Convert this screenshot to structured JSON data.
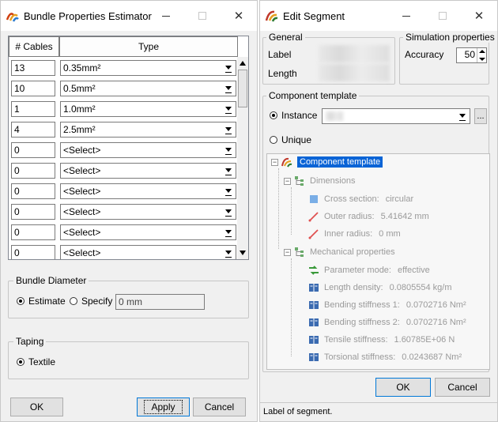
{
  "bundle_window": {
    "title": "Bundle Properties Estimator",
    "columns": [
      "# Cables",
      "Type"
    ],
    "rows": [
      {
        "count": "13",
        "type": "0.35mm²"
      },
      {
        "count": "10",
        "type": "0.5mm²"
      },
      {
        "count": "1",
        "type": "1.0mm²"
      },
      {
        "count": "4",
        "type": "2.5mm²"
      },
      {
        "count": "0",
        "type": "<Select>"
      },
      {
        "count": "0",
        "type": "<Select>"
      },
      {
        "count": "0",
        "type": "<Select>"
      },
      {
        "count": "0",
        "type": "<Select>"
      },
      {
        "count": "0",
        "type": "<Select>"
      },
      {
        "count": "0",
        "type": "<Select>"
      }
    ],
    "bundle_diameter": {
      "label": "Bundle Diameter",
      "estimate_label": "Estimate",
      "specify_label": "Specify",
      "value": "0 mm"
    },
    "taping": {
      "label": "Taping",
      "textile_label": "Textile"
    },
    "buttons": {
      "ok": "OK",
      "apply": "Apply",
      "cancel": "Cancel"
    }
  },
  "segment_window": {
    "title": "Edit Segment",
    "general": {
      "label": "General",
      "label_field": "Label",
      "length_field": "Length"
    },
    "simulation": {
      "label": "Simulation properties",
      "accuracy_label": "Accuracy",
      "accuracy_value": "50"
    },
    "component_template": {
      "label": "Component template",
      "instance_label": "Instance",
      "unique_label": "Unique",
      "browse_label": "..."
    },
    "tree": {
      "root": "Component template",
      "dimensions": {
        "label": "Dimensions",
        "items": [
          {
            "label": "Cross section:",
            "value": "circular",
            "icon": "square-icon"
          },
          {
            "label": "Outer radius:",
            "value": "5.41642 mm",
            "icon": "radius-icon"
          },
          {
            "label": "Inner radius:",
            "value": "0 mm",
            "icon": "radius-icon"
          }
        ]
      },
      "mechanical": {
        "label": "Mechanical properties",
        "items": [
          {
            "label": "Parameter mode:",
            "value": "effective",
            "icon": "mode-icon"
          },
          {
            "label": "Length density:",
            "value": "0.0805554 kg/m",
            "icon": "book-icon"
          },
          {
            "label": "Bending stiffness 1:",
            "value": "0.0702716 Nm²",
            "icon": "book-icon"
          },
          {
            "label": "Bending stiffness 2:",
            "value": "0.0702716 Nm²",
            "icon": "book-icon"
          },
          {
            "label": "Tensile stiffness:",
            "value": "1.60785E+06 N",
            "icon": "book-icon"
          },
          {
            "label": "Torsional stiffness:",
            "value": "0.0243687 Nm²",
            "icon": "book-icon"
          }
        ]
      }
    },
    "buttons": {
      "ok": "OK",
      "cancel": "Cancel"
    },
    "status": "Label of segment."
  }
}
